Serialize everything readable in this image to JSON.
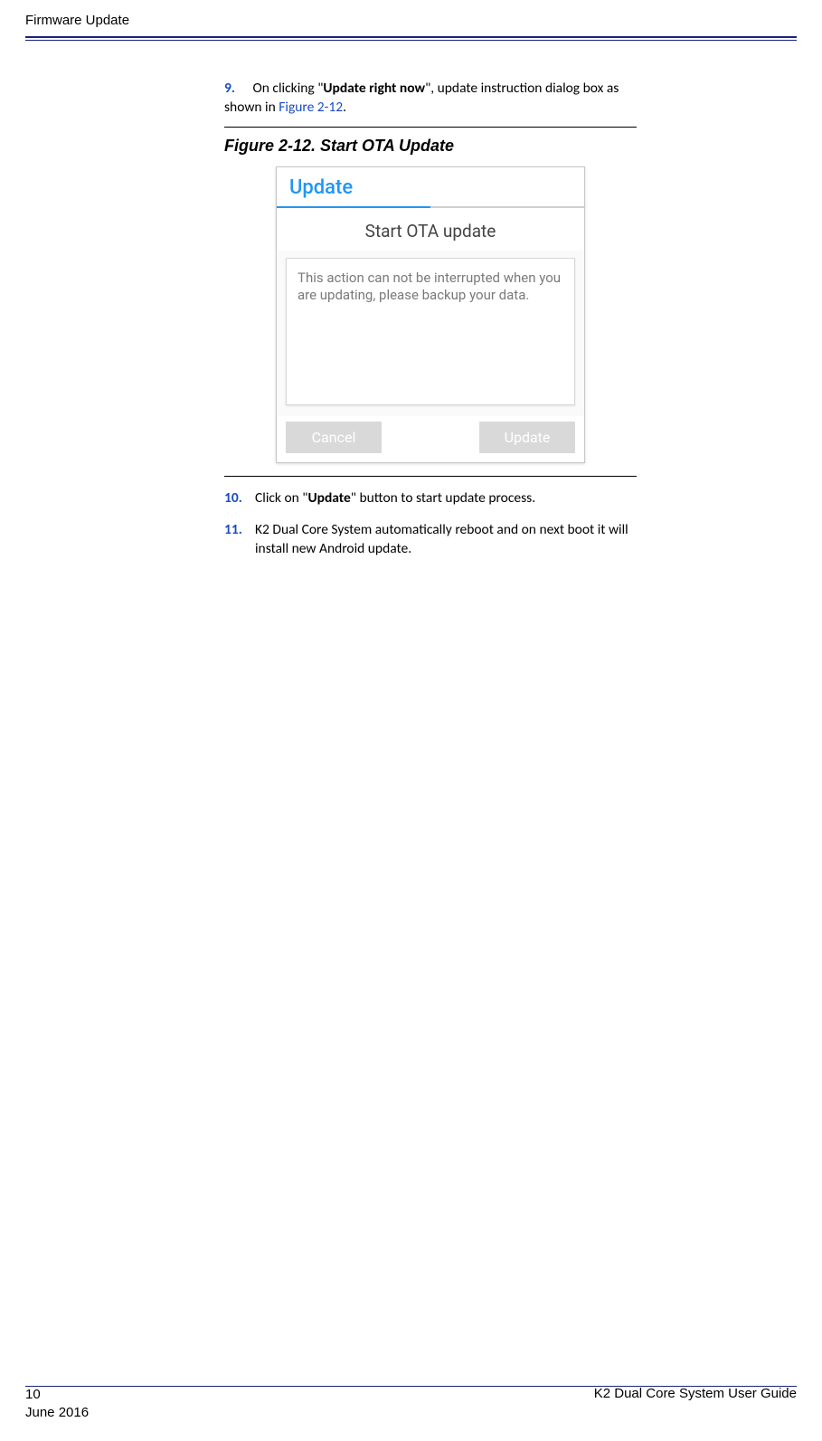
{
  "header": {
    "section": "Firmware Update"
  },
  "steps": {
    "s9": {
      "num": "9.",
      "text_pre": "On clicking \"",
      "bold1": "Update right now",
      "text_mid": "\", update instruction dialog box as shown in ",
      "link": "Figure 2-12",
      "text_post": "."
    },
    "s10": {
      "num": "10.",
      "text_pre": "Click on \"",
      "bold1": "Update",
      "text_post": "\" button to start update process."
    },
    "s11": {
      "num": "11.",
      "text": "K2 Dual Core System automatically reboot and on next boot it will install new Android update."
    }
  },
  "figure": {
    "caption": "Figure 2-12. Start OTA Update"
  },
  "dialog": {
    "wordmark": "Update",
    "title": "Start OTA update",
    "body": "This action can not be interrupted when you are updating, please backup your data.",
    "cancel": "Cancel",
    "update": "Update"
  },
  "footer": {
    "page": "10",
    "date": "June 2016",
    "guide": "K2 Dual Core System User Guide"
  }
}
